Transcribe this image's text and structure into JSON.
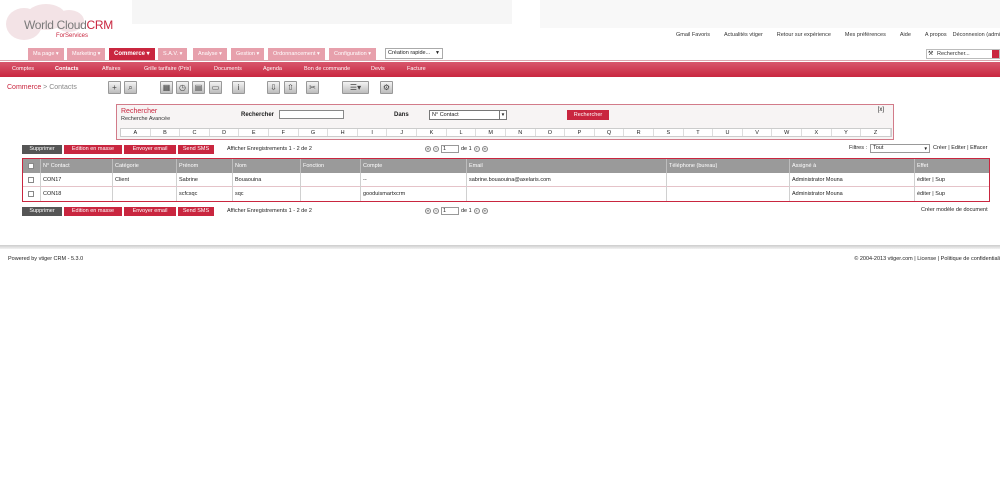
{
  "logo": {
    "world": "World Cloud",
    "crm": "CRM",
    "sub": "ForServices"
  },
  "toplinks": [
    "Gmail Favoris",
    "Actualités vtiger",
    "Retour sur expérience",
    "Mes préférences",
    "Aide",
    "A propos",
    "Déconnexion (admi"
  ],
  "menu": [
    "Ma page ▾",
    "Marketing ▾",
    "Commerce ▾",
    "S.A.V. ▾",
    "Analyse ▾",
    "Gestion ▾",
    "Ordonnancement ▾",
    "Configuration ▾"
  ],
  "quick_create": "Création rapide...",
  "global_search": "Rechercher...",
  "submenu": [
    "Comptes",
    "Contacts",
    "Affaires",
    "Grille tarifaire (Prix)",
    "Documents",
    "Agenda",
    "Bon de commande",
    "Devis",
    "Facture"
  ],
  "breadcrumb": {
    "module": "Commerce",
    "sep": " > ",
    "page": "Contacts"
  },
  "search": {
    "title": "Rechercher",
    "advanced": "Recherche Avancée",
    "label": "Rechercher",
    "in_label": "Dans",
    "field": "N° Contact",
    "button": "Rechercher",
    "close": "[x]",
    "letters": [
      "A",
      "B",
      "C",
      "D",
      "E",
      "F",
      "G",
      "H",
      "I",
      "J",
      "K",
      "L",
      "M",
      "N",
      "O",
      "P",
      "Q",
      "R",
      "S",
      "T",
      "U",
      "V",
      "W",
      "X",
      "Y",
      "Z"
    ]
  },
  "actions": {
    "delete": "Supprimer",
    "mass_edit": "Edition en masse",
    "send_email": "Envoyer email",
    "send_sms": "Send SMS"
  },
  "records_info": "Afficher Enregistrements 1 - 2 de 2",
  "pager": {
    "page": "1",
    "of": "de 1"
  },
  "filters": {
    "label": "Filtres :",
    "value": "Tout",
    "links": "Créer | Editer | Effacer"
  },
  "table": {
    "headers": [
      "N° Contact",
      "Catégorie",
      "Prénom",
      "Nom",
      "Fonction",
      "Compte",
      "Email",
      "Téléphone (bureau)",
      "Assigné à",
      "Effet"
    ],
    "rows": [
      [
        "CON17",
        "Client",
        "Sabrine",
        "Bouaouina",
        "",
        "--",
        "sabrine.bouaouina@axelaris.com",
        "",
        "Administrator Mouna",
        "éditer | Sup"
      ],
      [
        "CON18",
        "",
        "scfcsqc",
        "sqc",
        "",
        "gooduismartxcrm",
        "",
        "",
        "Administrator Mouna",
        "éditer | Sup"
      ]
    ]
  },
  "create_doc": "Créer modèle de document",
  "footer": {
    "left": "Powered by vtiger CRM - 5.3.0",
    "right": "© 2004-2013 vtiger.com | License | Politique de confidentiali"
  },
  "colors": {
    "brand": "#c9263f",
    "menu": "#e7a0ac",
    "header_row": "#9a9a9a"
  }
}
